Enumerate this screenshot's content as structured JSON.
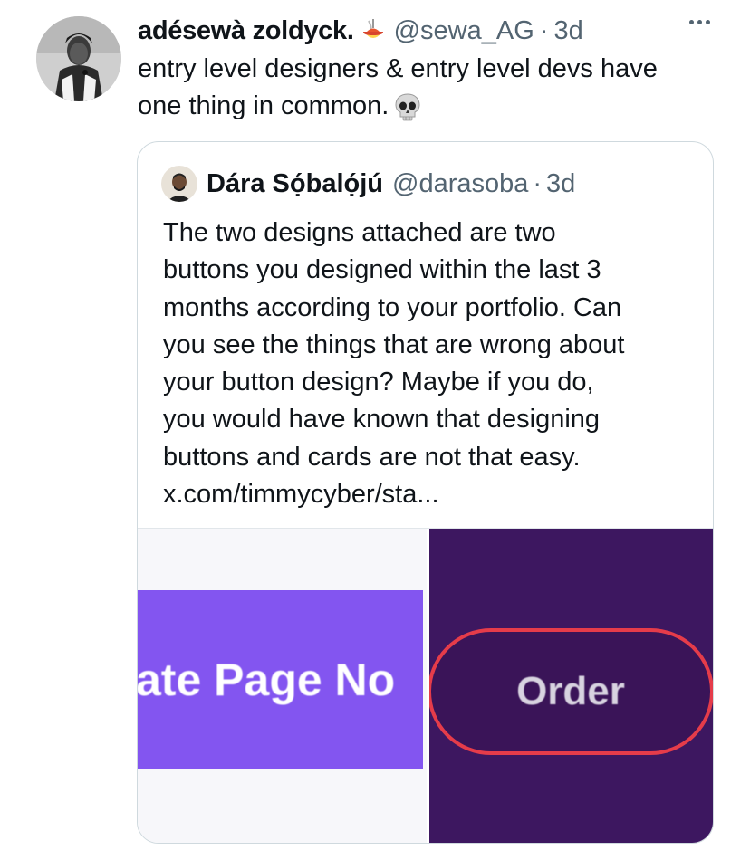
{
  "tweet": {
    "author": {
      "display_name": "adésewà zoldyck.",
      "name_emoji": "spaghetti-emoji",
      "handle": "@sewa_AG",
      "separator": "·",
      "time": "3d"
    },
    "text_lines": [
      "entry level designers & entry level devs have",
      "one thing in common."
    ],
    "text_emoji": "skull-emoji",
    "more_icon": "more-horizontal-icon"
  },
  "quote": {
    "author": {
      "display_name": "Dára Sọ́balọ́jú",
      "handle": "@darasoba",
      "separator": "·",
      "time": "3d"
    },
    "text_lines": [
      "The two designs attached are two",
      "buttons you designed within the last 3",
      "months according to your portfolio. Can",
      "you see the things that are wrong about",
      "your button design? Maybe if you do,",
      "you would have known that designing",
      "buttons and cards are not that easy.",
      "x.com/timmycyber/sta..."
    ],
    "media": [
      {
        "label": "ate Page No",
        "color": "#8355f0"
      },
      {
        "label": "Order",
        "background": "#3d1760",
        "border_color": "#e53c4a"
      }
    ]
  },
  "colors": {
    "text": "#0f1419",
    "secondary_text": "#536471",
    "border": "#cfd9de"
  }
}
